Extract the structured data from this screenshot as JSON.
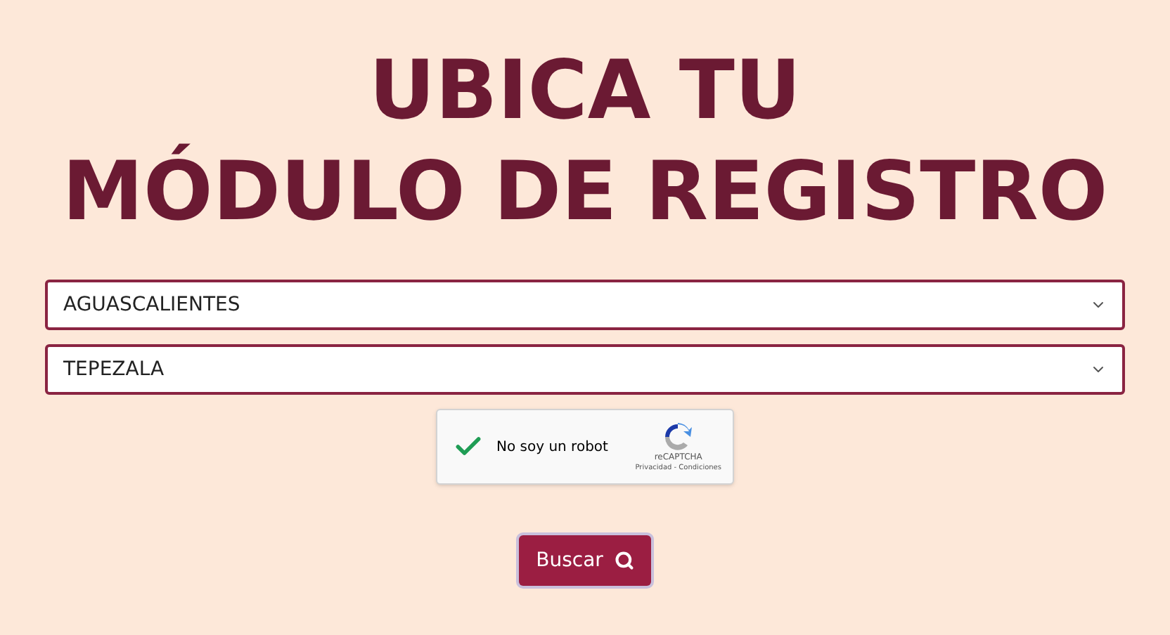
{
  "title_lines": [
    "UBICA TU",
    "MÓDULO DE REGISTRO"
  ],
  "selects": [
    {
      "value": "AGUASCALIENTES"
    },
    {
      "value": "TEPEZALA"
    }
  ],
  "captcha": {
    "label": "No soy un robot",
    "checked": true,
    "brand": "reCAPTCHA",
    "links": "Privacidad - Condiciones"
  },
  "search_button": {
    "label": "Buscar"
  }
}
